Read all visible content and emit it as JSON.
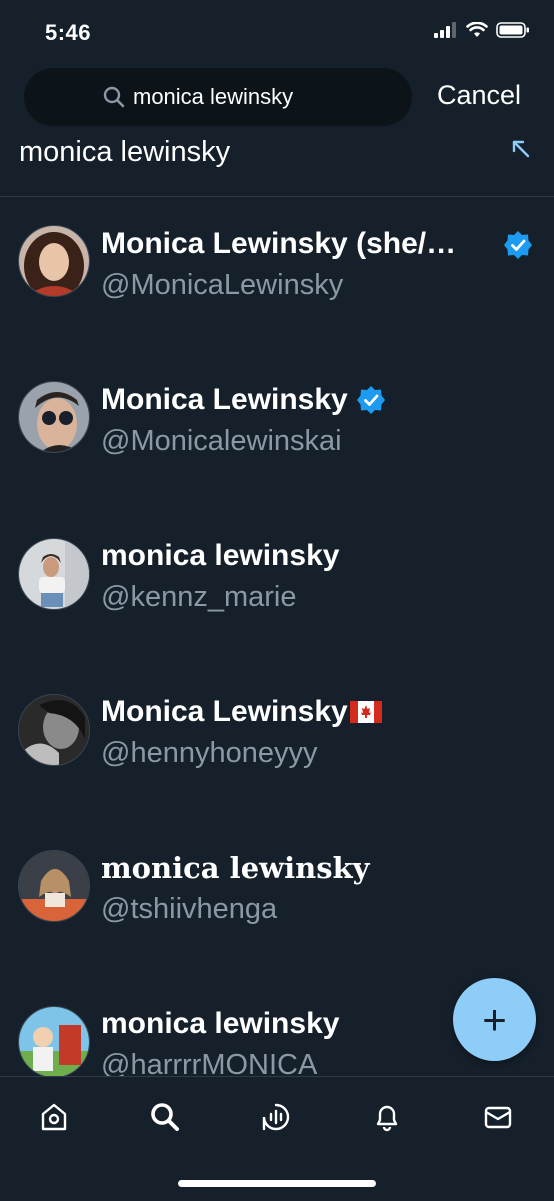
{
  "status_bar": {
    "time": "5:46"
  },
  "search": {
    "query": "monica lewinsky",
    "cancel_label": "Cancel"
  },
  "suggestion": {
    "text": "monica lewinsky"
  },
  "results": [
    {
      "name": "Monica Lewinsky (she/…",
      "handle": "@MonicaLewinsky",
      "verified": true
    },
    {
      "name": "Monica Lewinsky",
      "handle": "@Monicalewinskai",
      "verified": true
    },
    {
      "name": "monica lewinsky",
      "handle": "@kennz_marie",
      "verified": false
    },
    {
      "name": "Monica Lewinsky",
      "handle": "@hennyhoneyyy",
      "verified": false,
      "flag": "canada-flag"
    },
    {
      "name": "monica lewinsky",
      "handle": "@tshiivhenga",
      "verified": false
    },
    {
      "name": "monica lewinsky",
      "handle": "@harrrrMONICA",
      "verified": false
    }
  ],
  "fab": {
    "label": "+"
  },
  "tabs": [
    "home-icon",
    "search-icon",
    "spaces-icon",
    "bell-icon",
    "mail-icon"
  ],
  "colors": {
    "background": "#15202b",
    "accent": "#8ecdf7",
    "verified": "#1d9bf0",
    "secondary_text": "#8b98a5"
  }
}
